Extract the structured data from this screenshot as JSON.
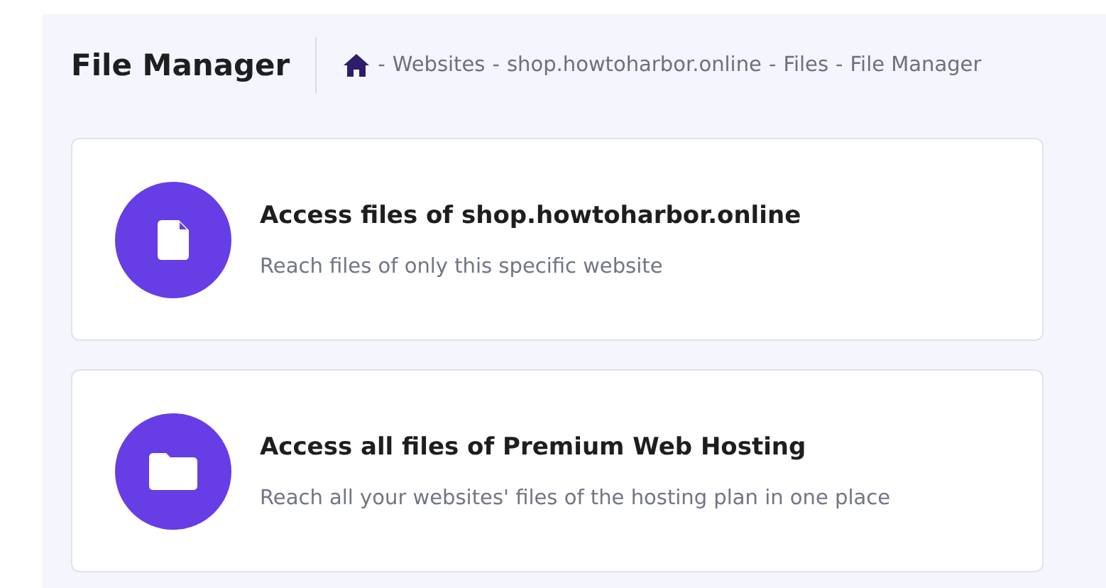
{
  "page_title": "File Manager",
  "breadcrumb": {
    "separator": "-",
    "items": [
      "Websites",
      "shop.howtoharbor.online",
      "Files",
      "File Manager"
    ]
  },
  "options": [
    {
      "kind": "file",
      "title": "Access files of shop.howtoharbor.online",
      "description": "Reach files of only this specific website"
    },
    {
      "kind": "folder",
      "title": "Access all files of Premium Web Hosting",
      "description": "Reach all your websites' files of the hosting plan in one place"
    }
  ]
}
